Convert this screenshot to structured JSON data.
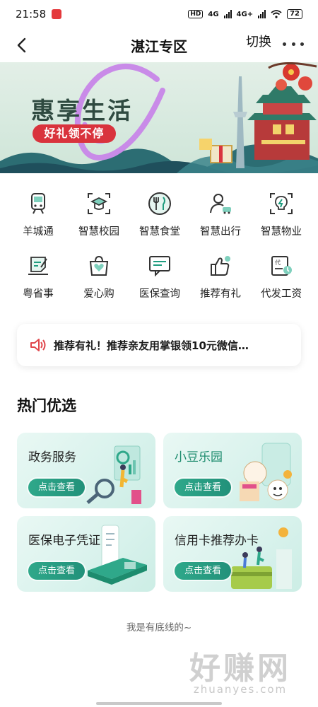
{
  "status_bar": {
    "time": "21:58",
    "network1": "4G",
    "network2": "4G+",
    "battery": "72",
    "hd": "HD"
  },
  "nav": {
    "title": "湛江专区",
    "switch_label": "切换"
  },
  "banner": {
    "title": "惠享生活",
    "tag": "好礼领不停"
  },
  "services": [
    {
      "label": "羊城通",
      "icon": "metro-train-icon"
    },
    {
      "label": "智慧校园",
      "icon": "graduation-cap-icon"
    },
    {
      "label": "智慧食堂",
      "icon": "fork-knife-icon"
    },
    {
      "label": "智慧出行",
      "icon": "person-car-icon"
    },
    {
      "label": "智慧物业",
      "icon": "lightbulb-icon"
    },
    {
      "label": "粤省事",
      "icon": "document-pen-icon"
    },
    {
      "label": "爱心购",
      "icon": "heart-bag-icon"
    },
    {
      "label": "医保查询",
      "icon": "message-doc-icon"
    },
    {
      "label": "推荐有礼",
      "icon": "thumbs-up-icon"
    },
    {
      "label": "代发工资",
      "icon": "payroll-doc-icon"
    }
  ],
  "notice": {
    "text": "推荐有礼！推荐亲友用掌银领10元微信…"
  },
  "section": {
    "title": "热门优选"
  },
  "cards": [
    {
      "title": "政务服务",
      "button": "点击查看"
    },
    {
      "title": "小豆乐园",
      "button": "点击查看"
    },
    {
      "title": "医保电子凭证",
      "button": "点击查看"
    },
    {
      "title": "信用卡推荐办卡",
      "button": "点击查看"
    }
  ],
  "footer": {
    "text": "我是有底线的~"
  },
  "watermark": {
    "main": "好赚网",
    "sub": "zhuanyes.com"
  },
  "colors": {
    "accent": "#2fa88a",
    "banner_red": "#d9333d",
    "speaker_red": "#e0474c"
  }
}
